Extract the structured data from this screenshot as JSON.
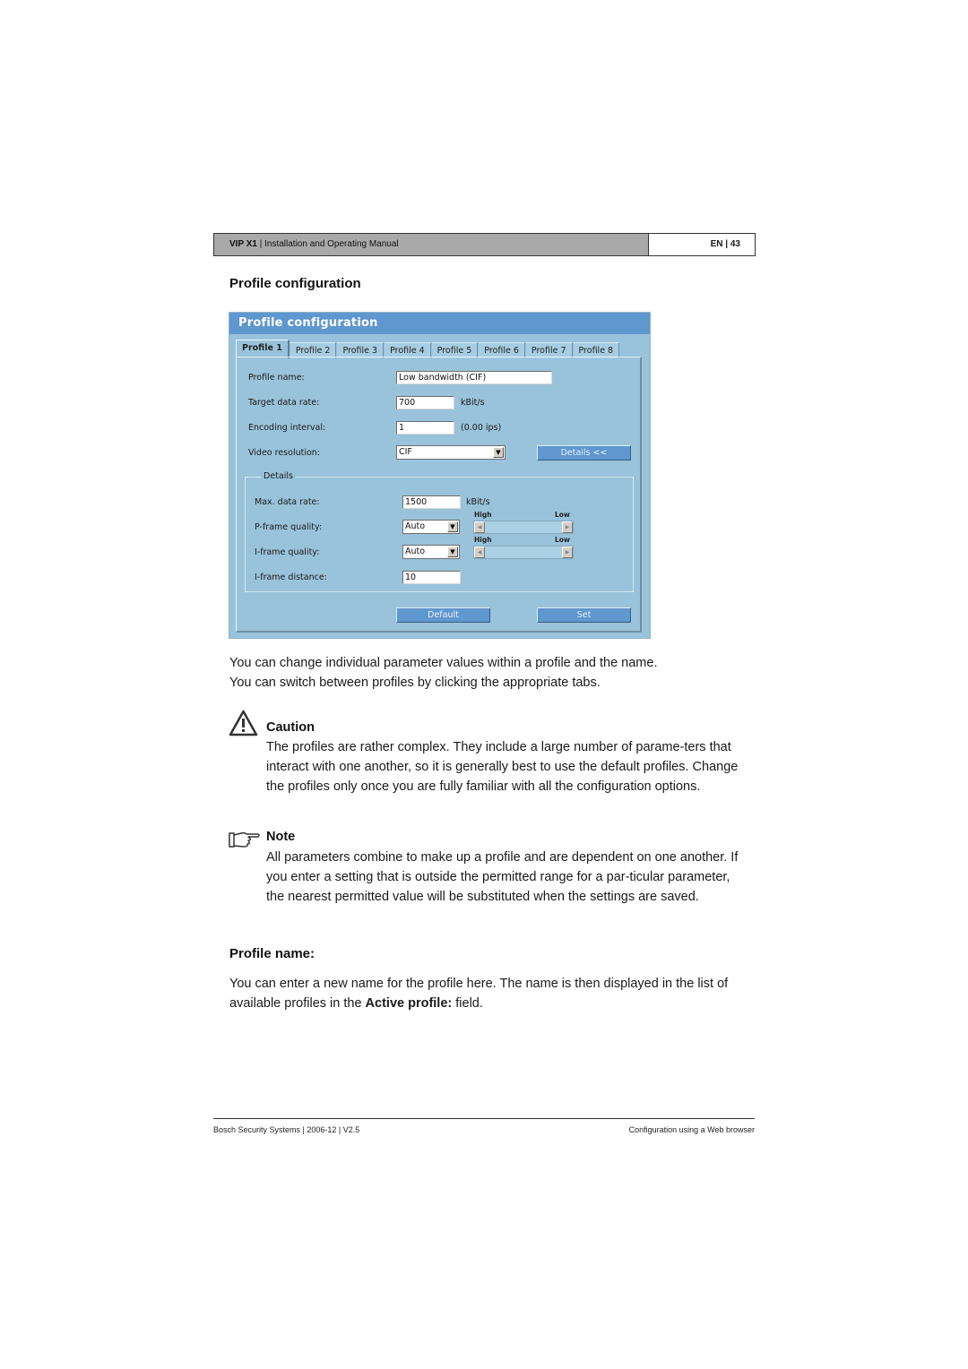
{
  "header": {
    "product": "VIP X1",
    "separator": " | ",
    "manual": "Installation and Operating Manual",
    "page_ref": "EN | 43"
  },
  "section_title": "Profile configuration",
  "screenshot": {
    "title": "Profile configuration",
    "tabs": [
      {
        "label": "Profile 1",
        "active": true
      },
      {
        "label": "Profile 2",
        "active": false
      },
      {
        "label": "Profile 3",
        "active": false
      },
      {
        "label": "Profile 4",
        "active": false
      },
      {
        "label": "Profile 5",
        "active": false
      },
      {
        "label": "Profile 6",
        "active": false
      },
      {
        "label": "Profile 7",
        "active": false
      },
      {
        "label": "Profile 8",
        "active": false
      }
    ],
    "fields": {
      "profile_name": {
        "label": "Profile name:",
        "value": "Low bandwidth (CIF)"
      },
      "target_data_rate": {
        "label": "Target data rate:",
        "value": "700",
        "unit": "kBit/s"
      },
      "encoding_interval": {
        "label": "Encoding interval:",
        "value": "1",
        "unit": "(0.00 ips)"
      },
      "video_resolution": {
        "label": "Video resolution:",
        "value": "CIF"
      }
    },
    "details_button": "Details <<",
    "details": {
      "legend": "Details",
      "max_data_rate": {
        "label": "Max. data rate:",
        "value": "1500",
        "unit": "kBit/s"
      },
      "p_frame_quality": {
        "label": "P-frame quality:",
        "value": "Auto",
        "slider_high": "High",
        "slider_low": "Low"
      },
      "i_frame_quality": {
        "label": "I-frame quality:",
        "value": "Auto",
        "slider_high": "High",
        "slider_low": "Low"
      },
      "i_frame_distance": {
        "label": "I-frame distance:",
        "value": "10"
      }
    },
    "buttons": {
      "default": "Default",
      "set": "Set"
    }
  },
  "intro": [
    "You can change individual parameter values within a profile and the name.",
    "You can switch between profiles by clicking the appropriate tabs."
  ],
  "caution": {
    "icon": "warning-triangle-icon",
    "title": "Caution",
    "text": "The profiles are rather complex. They include a large number of parame-ters that interact with one another, so it is generally best to use the default profiles. Change the profiles only once you are fully familiar with all the configuration options."
  },
  "note": {
    "icon": "pointing-hand-icon",
    "title": "Note",
    "text": "All parameters combine to make up a profile and are dependent on one another. If you enter a setting that is outside the permitted range for a par-ticular parameter, the nearest permitted value will be substituted when the settings are saved."
  },
  "profile_name_section": {
    "title": "Profile name:",
    "text_before": "You can enter a new name for the profile here. The name is then displayed in the list of available profiles in the ",
    "bold": "Active profile:",
    "text_after": " field."
  },
  "footer": {
    "left": "Bosch Security Systems | 2006-12 | V2.5",
    "right": "Configuration using a Web browser"
  }
}
